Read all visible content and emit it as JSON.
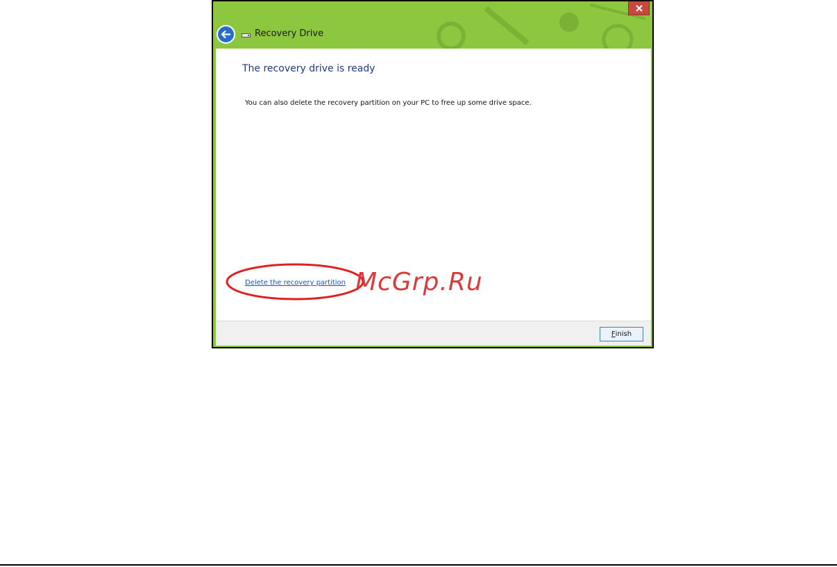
{
  "window": {
    "title": "Recovery Drive",
    "icons": {
      "back": "back-arrow-icon",
      "drive": "drive-icon",
      "close": "close-icon"
    },
    "colors": {
      "frame": "#8dc63f",
      "close_button": "#c7483e",
      "back_button": "#2a6cc9"
    }
  },
  "content": {
    "heading": "The recovery drive is ready",
    "body": "You can also delete the recovery partition on your PC to free up some drive space.",
    "delete_link": "Delete the recovery partition"
  },
  "footer": {
    "finish_accel": "F",
    "finish_rest": "inish"
  },
  "annotation": {
    "watermark": "McGrp.Ru",
    "highlight_color": "#e02020"
  }
}
